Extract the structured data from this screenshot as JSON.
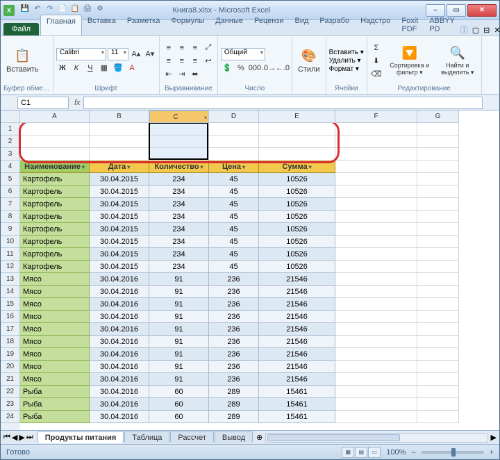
{
  "title": "Книга8.xlsx - Microsoft Excel",
  "qat": [
    "💾",
    "↶",
    "↷",
    "📄",
    "📋",
    "🖨",
    "⚙"
  ],
  "tabs": {
    "file": "Файл",
    "items": [
      "Главная",
      "Вставка",
      "Разметка",
      "Формулы",
      "Данные",
      "Рецензи",
      "Вид",
      "Разрабо",
      "Надстро",
      "Foxit PDF",
      "ABBYY PD"
    ],
    "active": 0
  },
  "ribbon": {
    "clipboard": {
      "paste": "Вставить",
      "label": "Буфер обме…"
    },
    "font": {
      "name": "Calibri",
      "size": "11",
      "label": "Шрифт"
    },
    "align": {
      "label": "Выравнивание"
    },
    "number": {
      "format": "Общий",
      "label": "Число"
    },
    "styles": {
      "btn": "Стили",
      "label": ""
    },
    "cells": {
      "insert": "Вставить ▾",
      "delete": "Удалить ▾",
      "format": "Формат ▾",
      "label": "Ячейки"
    },
    "editing": {
      "sort": "Сортировка и фильтр ▾",
      "find": "Найти и выделить ▾",
      "label": "Редактирование"
    }
  },
  "namebox": "C1",
  "columns": [
    "A",
    "B",
    "C",
    "D",
    "E",
    "F",
    "G"
  ],
  "selected_col_idx": 2,
  "headers": [
    "Наименование",
    "Дата",
    "Количество",
    "Цена",
    "Сумма"
  ],
  "rows": [
    {
      "n": "Картофель",
      "d": "30.04.2015",
      "q": "234",
      "p": "45",
      "s": "10526"
    },
    {
      "n": "Картофель",
      "d": "30.04.2015",
      "q": "234",
      "p": "45",
      "s": "10526"
    },
    {
      "n": "Картофель",
      "d": "30.04.2015",
      "q": "234",
      "p": "45",
      "s": "10526"
    },
    {
      "n": "Картофель",
      "d": "30.04.2015",
      "q": "234",
      "p": "45",
      "s": "10526"
    },
    {
      "n": "Картофель",
      "d": "30.04.2015",
      "q": "234",
      "p": "45",
      "s": "10526"
    },
    {
      "n": "Картофель",
      "d": "30.04.2015",
      "q": "234",
      "p": "45",
      "s": "10526"
    },
    {
      "n": "Картофель",
      "d": "30.04.2015",
      "q": "234",
      "p": "45",
      "s": "10526"
    },
    {
      "n": "Картофель",
      "d": "30.04.2015",
      "q": "234",
      "p": "45",
      "s": "10526"
    },
    {
      "n": "Мясо",
      "d": "30.04.2016",
      "q": "91",
      "p": "236",
      "s": "21546"
    },
    {
      "n": "Мясо",
      "d": "30.04.2016",
      "q": "91",
      "p": "236",
      "s": "21546"
    },
    {
      "n": "Мясо",
      "d": "30.04.2016",
      "q": "91",
      "p": "236",
      "s": "21546"
    },
    {
      "n": "Мясо",
      "d": "30.04.2016",
      "q": "91",
      "p": "236",
      "s": "21546"
    },
    {
      "n": "Мясо",
      "d": "30.04.2016",
      "q": "91",
      "p": "236",
      "s": "21546"
    },
    {
      "n": "Мясо",
      "d": "30.04.2016",
      "q": "91",
      "p": "236",
      "s": "21546"
    },
    {
      "n": "Мясо",
      "d": "30.04.2016",
      "q": "91",
      "p": "236",
      "s": "21546"
    },
    {
      "n": "Мясо",
      "d": "30.04.2016",
      "q": "91",
      "p": "236",
      "s": "21546"
    },
    {
      "n": "Мясо",
      "d": "30.04.2016",
      "q": "91",
      "p": "236",
      "s": "21546"
    },
    {
      "n": "Рыба",
      "d": "30.04.2016",
      "q": "60",
      "p": "289",
      "s": "15461"
    },
    {
      "n": "Рыба",
      "d": "30.04.2016",
      "q": "60",
      "p": "289",
      "s": "15461"
    },
    {
      "n": "Рыба",
      "d": "30.04.2016",
      "q": "60",
      "p": "289",
      "s": "15461"
    }
  ],
  "sheet_tabs": {
    "items": [
      "Продукты питания",
      "Таблица",
      "Рассчет",
      "Вывод"
    ],
    "active": 0
  },
  "status": {
    "ready": "Готово",
    "zoom": "100%"
  }
}
